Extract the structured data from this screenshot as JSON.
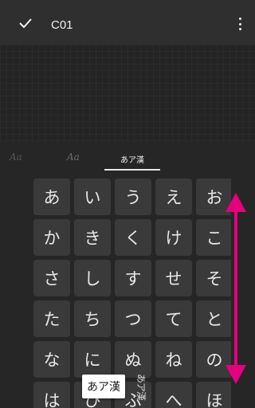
{
  "topbar": {
    "title": "C01"
  },
  "icons": {
    "confirm": "check-icon",
    "menu": "more-vert-icon"
  },
  "tabs": [
    {
      "label": "Aa"
    },
    {
      "label": "Aa"
    },
    {
      "label": "あア漢",
      "selected": true
    }
  ],
  "keyboard": {
    "rows": [
      [
        "あ",
        "い",
        "う",
        "え",
        "お"
      ],
      [
        "か",
        "き",
        "く",
        "け",
        "こ"
      ],
      [
        "さ",
        "し",
        "す",
        "せ",
        "そ"
      ],
      [
        "た",
        "ち",
        "つ",
        "て",
        "と"
      ],
      [
        "な",
        "に",
        "ぬ",
        "ね",
        "の"
      ],
      [
        "は",
        "ひ",
        "ふ",
        "へ",
        "ほ"
      ]
    ]
  },
  "popup": {
    "selected": "あア漢",
    "alternate": "あア漢"
  },
  "colors": {
    "accent_arrow": "#e5007e",
    "background": "#262626",
    "key": "#3a3a3a"
  }
}
